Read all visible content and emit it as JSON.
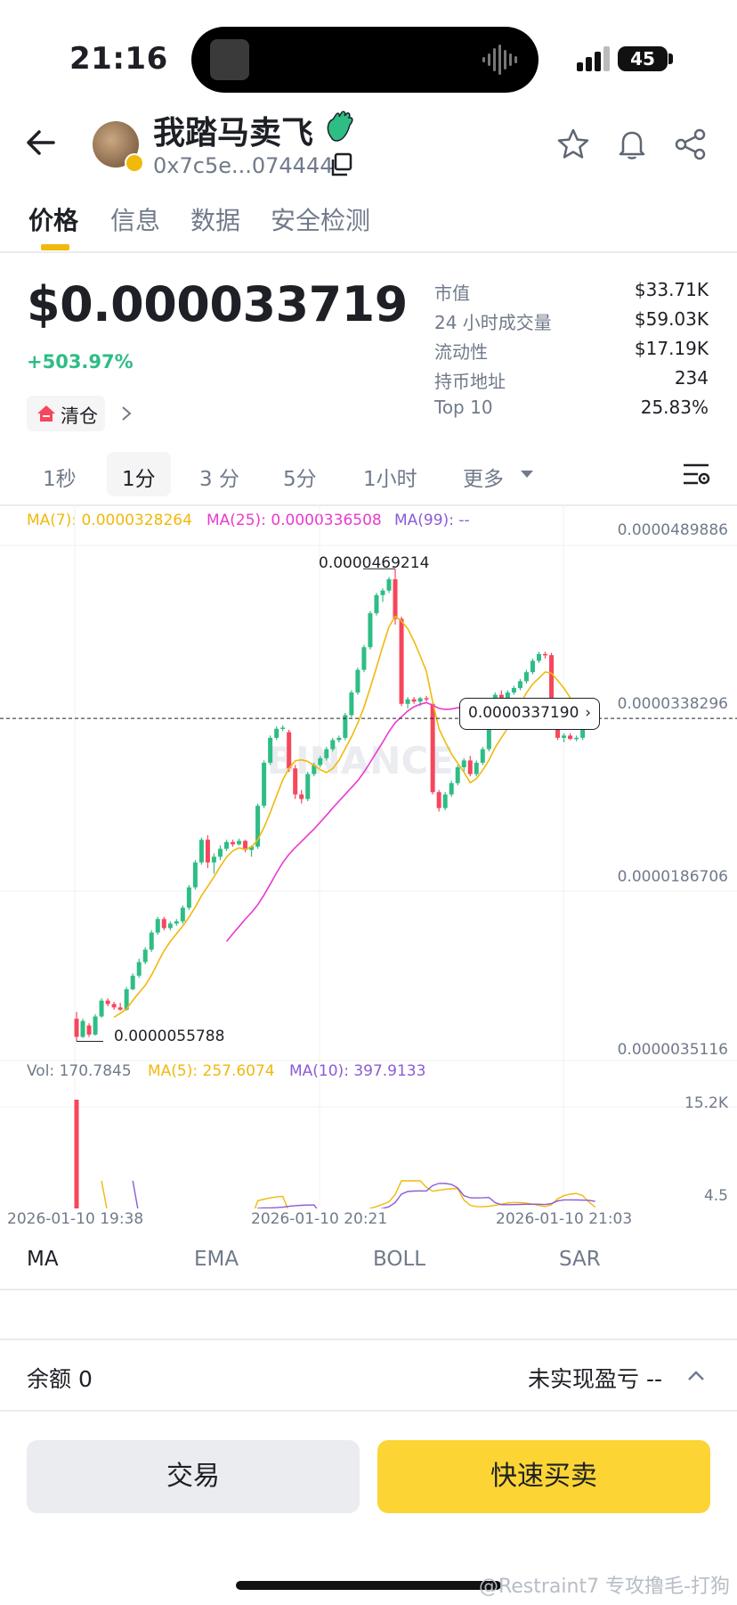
{
  "status_bar": {
    "time": "21:16",
    "battery": "45"
  },
  "header": {
    "token_name": "我踏马卖飞",
    "address": "0x7c5e...074444"
  },
  "tabs": [
    "价格",
    "信息",
    "数据",
    "安全检测"
  ],
  "price_block": {
    "price": "$0.000033719",
    "change": "+503.97%",
    "clear_label": "清仓",
    "stats": [
      {
        "label": "市值",
        "value": "$33.71K"
      },
      {
        "label": "24 小时成交量",
        "value": "$59.03K"
      },
      {
        "label": "流动性",
        "value": "$17.19K"
      },
      {
        "label": "持币地址",
        "value": "234"
      },
      {
        "label": "Top 10",
        "value": "25.83%"
      }
    ]
  },
  "intervals": {
    "items": [
      "1秒",
      "1分",
      "3 分",
      "5分",
      "1小时",
      "更多"
    ],
    "selected": "1分"
  },
  "chart": {
    "ma_legend": {
      "ma7": "MA(7): 0.0000328264",
      "ma25": "MA(25): 0.0000336508",
      "ma99": "MA(99): --"
    },
    "price_axis": [
      "0.0000489886",
      "0.0000338296",
      "0.0000186706",
      "0.0000035116"
    ],
    "high_label": "0.0000469214",
    "low_label": "0.0000055788",
    "current_callout": "0.0000337190",
    "watermark": "BINANCE",
    "vol_legend": {
      "vol": "Vol: 170.7845",
      "ma5": "MA(5): 257.6074",
      "ma10": "MA(10): 397.9133"
    },
    "vol_axis": [
      "15.2K",
      "4.5"
    ],
    "time_axis": [
      "2026-01-10 19:38",
      "2026-01-10 20:21",
      "2026-01-10 21:03"
    ],
    "colors": {
      "up": "#2ebd85",
      "down": "#f6465d",
      "ma7": "#f0b90b",
      "ma25": "#e93ad0",
      "ma99": "#8a5cd6"
    }
  },
  "chart_data": {
    "type": "candlestick",
    "ylim": [
      3.5116e-06,
      4.89886e-05
    ],
    "candles": [
      {
        "o": 7.2e-06,
        "h": 7.8e-06,
        "l": 5.2e-06,
        "c": 5.6e-06
      },
      {
        "o": 5.6e-06,
        "h": 7.2e-06,
        "l": 5.5e-06,
        "c": 7e-06
      },
      {
        "o": 6.6e-06,
        "h": 6.8e-06,
        "l": 5.5788e-06,
        "c": 5.8e-06
      },
      {
        "o": 5.8e-06,
        "h": 7.6e-06,
        "l": 5.7e-06,
        "c": 7.4e-06
      },
      {
        "o": 7.4e-06,
        "h": 9e-06,
        "l": 7.3e-06,
        "c": 8.8e-06
      },
      {
        "o": 8.8e-06,
        "h": 9e-06,
        "l": 8.3e-06,
        "c": 8.5e-06
      },
      {
        "o": 8.5e-06,
        "h": 8.7e-06,
        "l": 8e-06,
        "c": 8.2e-06
      },
      {
        "o": 8.2e-06,
        "h": 8.6e-06,
        "l": 7.9e-06,
        "c": 8e-06
      },
      {
        "o": 8e-06,
        "h": 1e-05,
        "l": 7.9e-06,
        "c": 9.8e-06
      },
      {
        "o": 9.8e-06,
        "h": 1.12e-05,
        "l": 9.7e-06,
        "c": 1.1e-05
      },
      {
        "o": 1.1e-05,
        "h": 1.25e-05,
        "l": 1.08e-05,
        "c": 1.22e-05
      },
      {
        "o": 1.22e-05,
        "h": 1.35e-05,
        "l": 1.2e-05,
        "c": 1.33e-05
      },
      {
        "o": 1.33e-05,
        "h": 1.5e-05,
        "l": 1.31e-05,
        "c": 1.48e-05
      },
      {
        "o": 1.48e-05,
        "h": 1.62e-05,
        "l": 1.46e-05,
        "c": 1.6e-05
      },
      {
        "o": 1.6e-05,
        "h": 1.62e-05,
        "l": 1.5e-05,
        "c": 1.52e-05
      },
      {
        "o": 1.52e-05,
        "h": 1.58e-05,
        "l": 1.5e-05,
        "c": 1.56e-05
      },
      {
        "o": 1.56e-05,
        "h": 1.6e-05,
        "l": 1.54e-05,
        "c": 1.58e-05
      },
      {
        "o": 1.58e-05,
        "h": 1.72e-05,
        "l": 1.56e-05,
        "c": 1.7e-05
      },
      {
        "o": 1.7e-05,
        "h": 1.9e-05,
        "l": 1.68e-05,
        "c": 1.88e-05
      },
      {
        "o": 1.88e-05,
        "h": 2.12e-05,
        "l": 1.86e-05,
        "c": 2.1e-05
      },
      {
        "o": 2.1e-05,
        "h": 2.32e-05,
        "l": 2.08e-05,
        "c": 2.3e-05
      },
      {
        "o": 2.3e-05,
        "h": 2.34e-05,
        "l": 2.05e-05,
        "c": 2.1e-05
      },
      {
        "o": 2.1e-05,
        "h": 2.18e-05,
        "l": 2e-05,
        "c": 2.15e-05
      },
      {
        "o": 2.15e-05,
        "h": 2.25e-05,
        "l": 2.12e-05,
        "c": 2.22e-05
      },
      {
        "o": 2.22e-05,
        "h": 2.3e-05,
        "l": 2.2e-05,
        "c": 2.28e-05
      },
      {
        "o": 2.28e-05,
        "h": 2.3e-05,
        "l": 2.24e-05,
        "c": 2.26e-05
      },
      {
        "o": 2.26e-05,
        "h": 2.31e-05,
        "l": 2.25e-05,
        "c": 2.29e-05
      },
      {
        "o": 2.29e-05,
        "h": 2.3e-05,
        "l": 2.19e-05,
        "c": 2.21e-05
      },
      {
        "o": 2.21e-05,
        "h": 2.25e-05,
        "l": 2.15e-05,
        "c": 2.24e-05
      },
      {
        "o": 2.24e-05,
        "h": 2.62e-05,
        "l": 2.22e-05,
        "c": 2.6e-05
      },
      {
        "o": 2.6e-05,
        "h": 3e-05,
        "l": 2.58e-05,
        "c": 2.98e-05
      },
      {
        "o": 2.98e-05,
        "h": 3.22e-05,
        "l": 2.96e-05,
        "c": 3.2e-05
      },
      {
        "o": 3.2e-05,
        "h": 3.3e-05,
        "l": 3.18e-05,
        "c": 3.28e-05
      },
      {
        "o": 3.28e-05,
        "h": 3.31e-05,
        "l": 3.26e-05,
        "c": 3.29e-05
      },
      {
        "o": 3.25e-05,
        "h": 3.27e-05,
        "l": 2.9e-05,
        "c": 2.93e-05
      },
      {
        "o": 2.93e-05,
        "h": 2.96e-05,
        "l": 2.66e-05,
        "c": 2.7e-05
      },
      {
        "o": 2.7e-05,
        "h": 2.74e-05,
        "l": 2.62e-05,
        "c": 2.66e-05
      },
      {
        "o": 2.66e-05,
        "h": 2.9e-05,
        "l": 2.64e-05,
        "c": 2.88e-05
      },
      {
        "o": 2.88e-05,
        "h": 2.98e-05,
        "l": 2.86e-05,
        "c": 2.96e-05
      },
      {
        "o": 2.96e-05,
        "h": 3.04e-05,
        "l": 2.94e-05,
        "c": 3.02e-05
      },
      {
        "o": 3.02e-05,
        "h": 3.12e-05,
        "l": 3e-05,
        "c": 3.1e-05
      },
      {
        "o": 3.1e-05,
        "h": 3.2e-05,
        "l": 3.08e-05,
        "c": 3.18e-05
      },
      {
        "o": 3.18e-05,
        "h": 3.22e-05,
        "l": 3.16e-05,
        "c": 3.2e-05
      },
      {
        "o": 3.2e-05,
        "h": 3.42e-05,
        "l": 3.18e-05,
        "c": 3.4e-05
      },
      {
        "o": 3.4e-05,
        "h": 3.62e-05,
        "l": 3.38e-05,
        "c": 3.6e-05
      },
      {
        "o": 3.6e-05,
        "h": 3.82e-05,
        "l": 3.58e-05,
        "c": 3.8e-05
      },
      {
        "o": 3.8e-05,
        "h": 4.02e-05,
        "l": 3.78e-05,
        "c": 4e-05
      },
      {
        "o": 4e-05,
        "h": 4.32e-05,
        "l": 3.98e-05,
        "c": 4.3e-05
      },
      {
        "o": 4.3e-05,
        "h": 4.48e-05,
        "l": 4.28e-05,
        "c": 4.46e-05
      },
      {
        "o": 4.46e-05,
        "h": 4.52e-05,
        "l": 4.4e-05,
        "c": 4.5e-05
      },
      {
        "o": 4.5e-05,
        "h": 4.62e-05,
        "l": 4.48e-05,
        "c": 4.6e-05
      },
      {
        "o": 4.6e-05,
        "h": 4.69214e-05,
        "l": 4.2e-05,
        "c": 4.25e-05
      },
      {
        "o": 4.25e-05,
        "h": 4.27e-05,
        "l": 3.48e-05,
        "c": 3.5e-05
      },
      {
        "o": 3.5e-05,
        "h": 3.56e-05,
        "l": 3.46e-05,
        "c": 3.54e-05
      },
      {
        "o": 3.54e-05,
        "h": 3.56e-05,
        "l": 3.5e-05,
        "c": 3.52e-05
      },
      {
        "o": 3.52e-05,
        "h": 3.56e-05,
        "l": 3.48e-05,
        "c": 3.55e-05
      },
      {
        "o": 3.55e-05,
        "h": 3.57e-05,
        "l": 3.52e-05,
        "c": 3.54e-05
      },
      {
        "o": 3.5e-05,
        "h": 3.52e-05,
        "l": 2.7e-05,
        "c": 2.72e-05
      },
      {
        "o": 2.72e-05,
        "h": 2.74e-05,
        "l": 2.55e-05,
        "c": 2.58e-05
      },
      {
        "o": 2.58e-05,
        "h": 2.72e-05,
        "l": 2.56e-05,
        "c": 2.7e-05
      },
      {
        "o": 2.7e-05,
        "h": 2.82e-05,
        "l": 2.68e-05,
        "c": 2.8e-05
      },
      {
        "o": 2.8e-05,
        "h": 2.96e-05,
        "l": 2.78e-05,
        "c": 2.94e-05
      },
      {
        "o": 2.94e-05,
        "h": 3.02e-05,
        "l": 2.9e-05,
        "c": 3e-05
      },
      {
        "o": 3e-05,
        "h": 3.04e-05,
        "l": 2.86e-05,
        "c": 2.88e-05
      },
      {
        "o": 2.88e-05,
        "h": 3e-05,
        "l": 2.86e-05,
        "c": 2.98e-05
      },
      {
        "o": 2.98e-05,
        "h": 3.12e-05,
        "l": 2.96e-05,
        "c": 3.1e-05
      },
      {
        "o": 3.1e-05,
        "h": 3.34e-05,
        "l": 3.08e-05,
        "c": 3.32e-05
      },
      {
        "o": 3.32e-05,
        "h": 3.6e-05,
        "l": 3.3e-05,
        "c": 3.58e-05
      },
      {
        "o": 3.58e-05,
        "h": 3.62e-05,
        "l": 3.52e-05,
        "c": 3.55e-05
      },
      {
        "o": 3.55e-05,
        "h": 3.62e-05,
        "l": 3.53e-05,
        "c": 3.6e-05
      },
      {
        "o": 3.6e-05,
        "h": 3.66e-05,
        "l": 3.58e-05,
        "c": 3.64e-05
      },
      {
        "o": 3.64e-05,
        "h": 3.72e-05,
        "l": 3.62e-05,
        "c": 3.7e-05
      },
      {
        "o": 3.7e-05,
        "h": 3.8e-05,
        "l": 3.68e-05,
        "c": 3.78e-05
      },
      {
        "o": 3.78e-05,
        "h": 3.9e-05,
        "l": 3.76e-05,
        "c": 3.88e-05
      },
      {
        "o": 3.88e-05,
        "h": 3.96e-05,
        "l": 3.86e-05,
        "c": 3.94e-05
      },
      {
        "o": 3.94e-05,
        "h": 3.96e-05,
        "l": 3.9e-05,
        "c": 3.93e-05
      },
      {
        "o": 3.93e-05,
        "h": 3.95e-05,
        "l": 3.5e-05,
        "c": 3.52e-05
      },
      {
        "o": 3.52e-05,
        "h": 3.54e-05,
        "l": 3.18e-05,
        "c": 3.2e-05
      },
      {
        "o": 3.2e-05,
        "h": 3.24e-05,
        "l": 3.16e-05,
        "c": 3.22e-05
      },
      {
        "o": 3.22e-05,
        "h": 3.24e-05,
        "l": 3.18e-05,
        "c": 3.19e-05
      },
      {
        "o": 3.19e-05,
        "h": 3.22e-05,
        "l": 3.17e-05,
        "c": 3.2e-05
      },
      {
        "o": 3.2e-05,
        "h": 3.32e-05,
        "l": 3.18e-05,
        "c": 3.3e-05
      },
      {
        "o": 3.3e-05,
        "h": 3.38e-05,
        "l": 3.28e-05,
        "c": 3.3719e-05
      }
    ],
    "volume": [
      15200,
      60,
      420,
      320,
      180,
      150,
      120,
      90,
      180,
      220,
      240,
      200,
      160,
      140,
      180,
      150,
      120,
      110,
      130,
      150,
      220,
      260,
      180,
      140,
      160,
      150,
      120,
      140,
      170,
      1900,
      300,
      260,
      240,
      220,
      340,
      280,
      200,
      180,
      200,
      220,
      260,
      240,
      230,
      260,
      300,
      340,
      380,
      420,
      460,
      520,
      600,
      1100,
      1900,
      800,
      400,
      380,
      360,
      1500,
      900,
      500,
      420,
      380,
      360,
      360,
      380,
      400,
      420,
      460,
      480,
      500,
      440,
      420,
      400,
      380,
      360,
      340,
      600,
      1000,
      700,
      500,
      420,
      380,
      360,
      170.7845
    ]
  },
  "indicator_tabs": [
    "MA",
    "EMA",
    "BOLL",
    "SAR"
  ],
  "balance": {
    "label": "余额 0",
    "unrealized": "未实现盈亏 --"
  },
  "buttons": {
    "trade": "交易",
    "quick": "快速买卖"
  },
  "footer_watermark": "@Restraint7 专攻撸毛-打狗"
}
